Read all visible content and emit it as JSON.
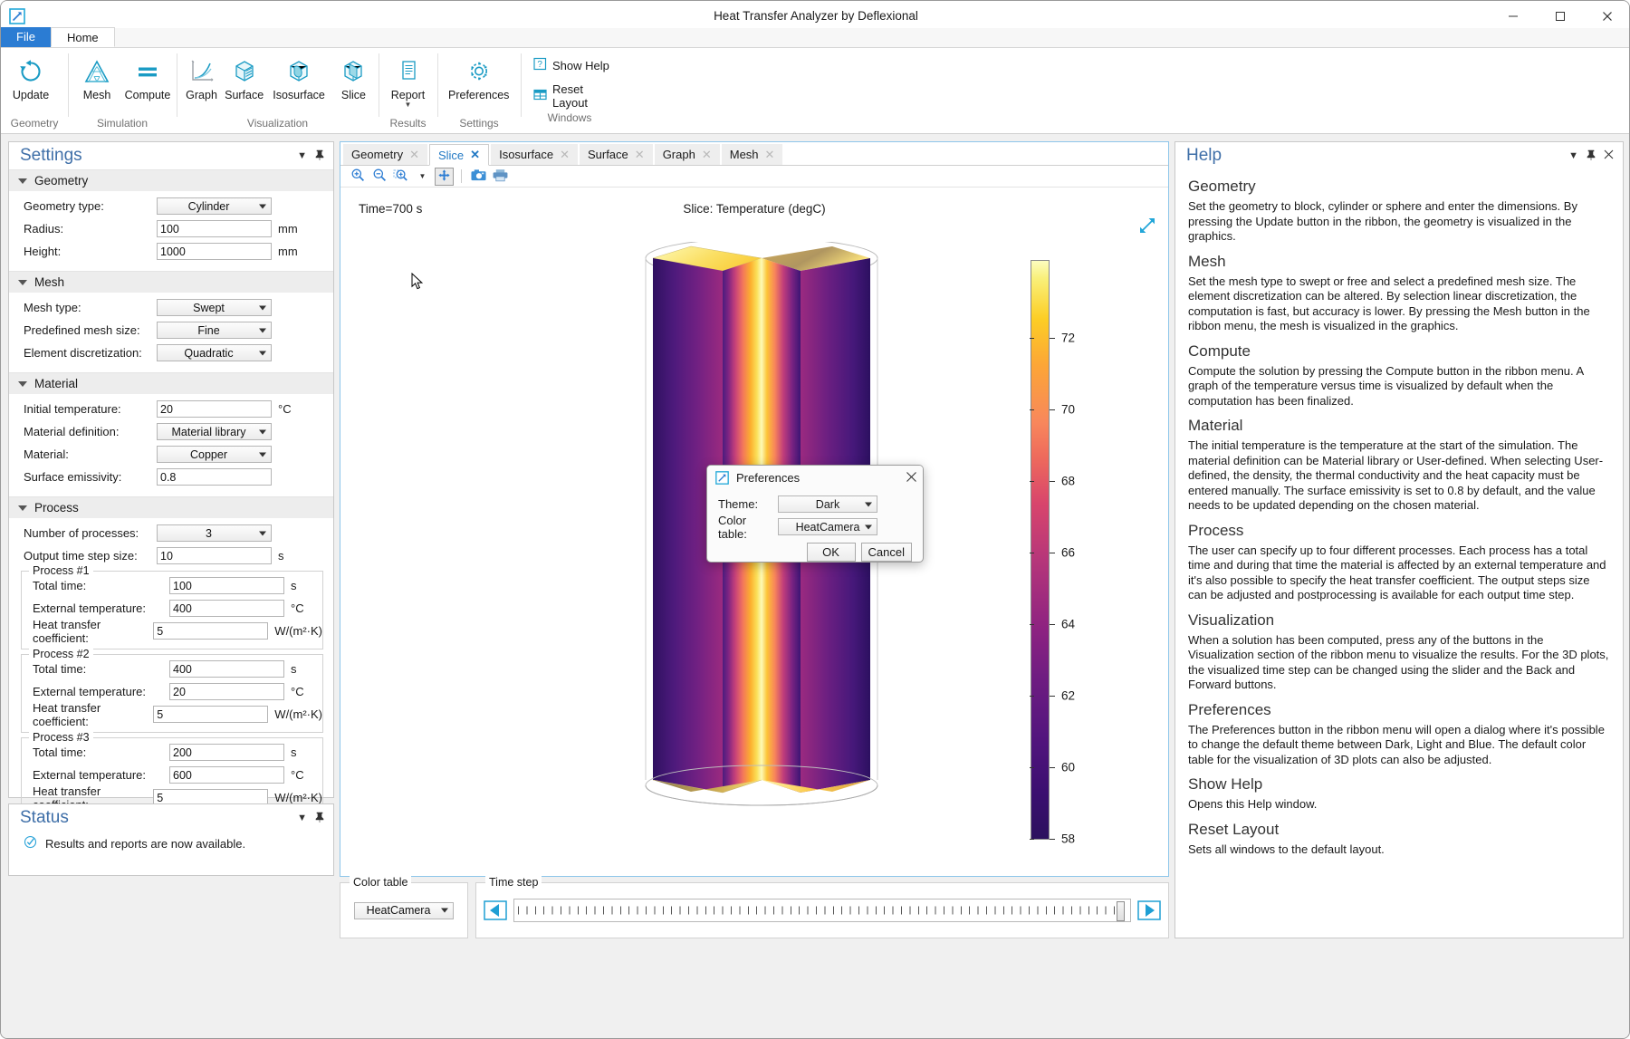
{
  "window": {
    "title": "Heat Transfer Analyzer by Deflexional",
    "app_icon": "app-logo-icon",
    "minimize": "–",
    "maximize": "□",
    "close": "✕"
  },
  "ribbon": {
    "tabs": [
      {
        "label": "File",
        "type": "file"
      },
      {
        "label": "Home",
        "type": "active"
      }
    ],
    "groups": [
      {
        "label": "Geometry",
        "buttons": [
          {
            "label": "Update",
            "icon": "refresh-icon"
          }
        ]
      },
      {
        "label": "Simulation",
        "buttons": [
          {
            "label": "Mesh",
            "icon": "mesh-triangle-icon"
          },
          {
            "label": "Compute",
            "icon": "equals-icon"
          }
        ]
      },
      {
        "label": "Visualization",
        "buttons": [
          {
            "label": "Graph",
            "icon": "graph-icon"
          },
          {
            "label": "Surface",
            "icon": "surface-cube-icon"
          },
          {
            "label": "Isosurface",
            "icon": "isosurface-cube-icon"
          },
          {
            "label": "Slice",
            "icon": "slice-cube-icon"
          }
        ]
      },
      {
        "label": "Results",
        "buttons": [
          {
            "label": "Report",
            "icon": "report-document-icon",
            "has_dropdown": true
          }
        ]
      },
      {
        "label": "Settings",
        "buttons": [
          {
            "label": "Preferences",
            "icon": "gear-icon"
          }
        ]
      },
      {
        "label": "Windows",
        "small_buttons": [
          {
            "label": "Show Help",
            "icon": "question-box-icon"
          },
          {
            "label": "Reset Layout",
            "icon": "layout-grid-icon"
          }
        ]
      }
    ]
  },
  "settings": {
    "title": "Settings",
    "sections": [
      {
        "name": "Geometry",
        "rows": [
          {
            "label": "Geometry type:",
            "kind": "combo",
            "value": "Cylinder",
            "unit": ""
          },
          {
            "label": "Radius:",
            "kind": "text",
            "value": "100",
            "unit": "mm"
          },
          {
            "label": "Height:",
            "kind": "text",
            "value": "1000",
            "unit": "mm"
          }
        ]
      },
      {
        "name": "Mesh",
        "rows": [
          {
            "label": "Mesh type:",
            "kind": "combo",
            "value": "Swept",
            "unit": ""
          },
          {
            "label": "Predefined mesh size:",
            "kind": "combo",
            "value": "Fine",
            "unit": ""
          },
          {
            "label": "Element discretization:",
            "kind": "combo",
            "value": "Quadratic",
            "unit": ""
          }
        ]
      },
      {
        "name": "Material",
        "rows": [
          {
            "label": "Initial temperature:",
            "kind": "text",
            "value": "20",
            "unit": "°C"
          },
          {
            "label": "Material definition:",
            "kind": "combo",
            "value": "Material library",
            "unit": ""
          },
          {
            "label": "Material:",
            "kind": "combo",
            "value": "Copper",
            "unit": ""
          },
          {
            "label": "Surface emissivity:",
            "kind": "text",
            "value": "0.8",
            "unit": ""
          }
        ]
      },
      {
        "name": "Process",
        "rows": [
          {
            "label": "Number of processes:",
            "kind": "combo",
            "value": "3",
            "unit": ""
          },
          {
            "label": "Output time step size:",
            "kind": "text",
            "value": "10",
            "unit": "s"
          }
        ],
        "groups": [
          {
            "legend": "Process #1",
            "rows": [
              {
                "label": "Total time:",
                "kind": "text",
                "value": "100",
                "unit": "s"
              },
              {
                "label": "External temperature:",
                "kind": "text",
                "value": "400",
                "unit": "°C"
              },
              {
                "label": "Heat transfer coefficient:",
                "kind": "text",
                "value": "5",
                "unit": "W/(m²·K)"
              }
            ]
          },
          {
            "legend": "Process #2",
            "rows": [
              {
                "label": "Total time:",
                "kind": "text",
                "value": "400",
                "unit": "s"
              },
              {
                "label": "External temperature:",
                "kind": "text",
                "value": "20",
                "unit": "°C"
              },
              {
                "label": "Heat transfer coefficient:",
                "kind": "text",
                "value": "5",
                "unit": "W/(m²·K)"
              }
            ]
          },
          {
            "legend": "Process #3",
            "rows": [
              {
                "label": "Total time:",
                "kind": "text",
                "value": "200",
                "unit": "s"
              },
              {
                "label": "External temperature:",
                "kind": "text",
                "value": "600",
                "unit": "°C"
              },
              {
                "label": "Heat transfer coefficient:",
                "kind": "text",
                "value": "5",
                "unit": "W/(m²·K)"
              }
            ]
          }
        ]
      }
    ]
  },
  "status": {
    "title": "Status",
    "icon": "check-circle-icon",
    "message": "Results and reports are now available."
  },
  "graphics": {
    "tabs": [
      {
        "label": "Geometry",
        "active": false
      },
      {
        "label": "Slice",
        "active": true
      },
      {
        "label": "Isosurface",
        "active": false
      },
      {
        "label": "Surface",
        "active": false
      },
      {
        "label": "Graph",
        "active": false
      },
      {
        "label": "Mesh",
        "active": false
      }
    ],
    "toolbar": [
      {
        "icon": "zoom-in-icon"
      },
      {
        "icon": "zoom-out-icon"
      },
      {
        "icon": "zoom-box-icon",
        "has_dropdown": true
      },
      {
        "icon": "zoom-extents-icon"
      },
      {
        "icon": "camera-icon"
      },
      {
        "icon": "print-icon"
      }
    ],
    "time_label": "Time=700 s",
    "plot_title": "Slice: Temperature (degC)",
    "expand_icon": "expand-arrow-icon"
  },
  "chart_data": {
    "type": "heatmap",
    "title": "Slice: Temperature (degC)",
    "annotation": "Time=700 s",
    "colorbar": {
      "colormap": "HeatCamera",
      "min": 57.2,
      "max": 73.4,
      "tick_labels": [
        "72",
        "70",
        "68",
        "66",
        "64",
        "62",
        "60",
        "58"
      ],
      "tick_values": [
        72,
        70,
        68,
        66,
        64,
        62,
        60,
        58
      ],
      "unit": "degC"
    },
    "geometry": {
      "shape": "Cylinder",
      "radius_mm": 100,
      "height_mm": 1000
    },
    "description": "Slice plot of temperature through a vertical copper cylinder; warm (yellow/orange) near outer surface and top/bottom faces, cool (purple) in the core."
  },
  "bottom": {
    "color_table": {
      "legend": "Color table",
      "value": "HeatCamera"
    },
    "time_step": {
      "legend": "Time step",
      "back_icon": "step-back-icon",
      "forward_icon": "step-forward-icon"
    }
  },
  "help": {
    "title": "Help",
    "icons": {
      "collapse": "chevron-down-icon",
      "pin": "pin-icon",
      "close": "close-icon"
    },
    "sections": [
      {
        "heading": "Geometry",
        "text": "Set the geometry to block, cylinder or sphere and enter the dimensions. By pressing the Update button in the ribbon, the geometry is visualized in the graphics."
      },
      {
        "heading": "Mesh",
        "text": "Set the mesh type to swept or free and select a predefined mesh size.  The element discretization can be altered. By selection linear discretization, the computation is fast, but accuracy is lower.  By pressing the Mesh button in the ribbon menu, the mesh is visualized in the graphics."
      },
      {
        "heading": "Compute",
        "text": "Compute the solution by pressing the Compute button in the ribbon menu. A graph of the temperature versus time is visualized by default when the computation has been finalized."
      },
      {
        "heading": "Material",
        "text": "The initial temperature is the temperature at the start of the simulation. The material definition can be Material library or User-defined. When selecting User-defined, the density, the thermal conductivity and the heat capacity must be entered manually. The surface emissivity is set to 0.8 by default, and the value needs to be updated depending on the chosen material."
      },
      {
        "heading": "Process",
        "text": "The user can specify up to four different processes. Each process has a total time and during that time the material is affected by an external temperature and it's also possible to specify the heat transfer coefficient. The output steps size can be adjusted and postprocessing is available for each output time step."
      },
      {
        "heading": "Visualization",
        "text": "When a solution has been computed, press any of the buttons in the Visualization section of the ribbon menu to visualize the results. For the 3D plots, the visualized time step can be changed using the slider and the Back and Forward buttons."
      },
      {
        "heading": "Preferences",
        "text": "The Preferences button in the ribbon menu will open a dialog where it's possible to change the default theme between Dark, Light and Blue. The default color table for the visualization of 3D plots can also be adjusted."
      },
      {
        "heading": "Show Help",
        "text": "Opens this Help window."
      },
      {
        "heading": "Reset Layout",
        "text": "Sets all windows to the default layout."
      }
    ]
  },
  "dialog": {
    "title": "Preferences",
    "icon": "app-logo-icon",
    "close_icon": "close-icon",
    "rows": [
      {
        "label": "Theme:",
        "value": "Dark"
      },
      {
        "label": "Color table:",
        "value": "HeatCamera"
      }
    ],
    "ok": "OK",
    "cancel": "Cancel"
  },
  "colors": {
    "accent": "#2b7cd3",
    "teal": "#2aa3c0",
    "panel_title": "#3f6fa8",
    "tab_active": "#2279c4"
  }
}
